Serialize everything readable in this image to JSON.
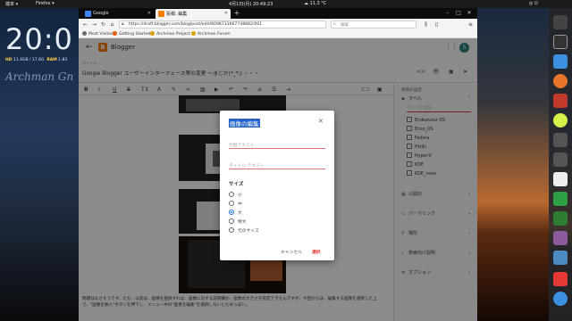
{
  "panel": {
    "menu": "端末 ▾",
    "app": "Firefox ▾",
    "datetime": "4月1日(月) 20:49:23",
    "weather": "☁ 11.3 °C"
  },
  "desktop": {
    "clock": "20:0",
    "stats_hd_label": "HD",
    "stats_hd": "11.4GB / 17.6G",
    "stats_ram_label": "RAM",
    "stats_ram": "1.83",
    "signature": "Archman Gn"
  },
  "browser": {
    "tabs": [
      {
        "label": "Google",
        "active": false,
        "color": "#4285f4"
      },
      {
        "label": "投稿: 編集",
        "active": true,
        "color": "#f57d00"
      }
    ],
    "url": "https://draft.blogger.com/blog/post/edit/6098733667748682/001",
    "search_placeholder": "検索",
    "bookmarks": [
      {
        "label": "Most Visited",
        "color": "#6a6a6a"
      },
      {
        "label": "Getting Started",
        "color": "#e66000"
      },
      {
        "label": "Archman Project",
        "color": "#d8a000"
      },
      {
        "label": "Archman Forum",
        "color": "#d8a000"
      }
    ]
  },
  "app": {
    "name": "Blogger",
    "avatar": "S",
    "title_hint": "タイトル",
    "post_title": "Google Blogger ユーザーインターフェース等の変更 ～まじか(*_*;) ・・・"
  },
  "editor": {
    "paragraph": "問題はなさそうです。ただ、以前は、画像を選択すれば、画像に対する説明欄か、画像の大きさを指定できたんですが、今回からは、編集する画像を選択した上で、\"画像を挿入\"ボタンを押下し、メニュー中の\"画像を編集\"を選択しないとだめっぽい。"
  },
  "sidebar": {
    "heading": "投稿の設定",
    "labels_section": "ラベル",
    "labels_placeholder": "ラベルを追加",
    "labels": [
      "Endeavour OS",
      "Enso_OS",
      "Fedora",
      "Hiziki",
      "Hyper-V",
      "KDE",
      "KDE_neon"
    ],
    "sections": [
      {
        "icon": "calendar-icon",
        "label": "公開日"
      },
      {
        "icon": "link-icon",
        "label": "パーマリンク"
      },
      {
        "icon": "location-icon",
        "label": "場所"
      },
      {
        "icon": "search-desc-icon",
        "label": "検索向け説明"
      },
      {
        "icon": "gear-icon",
        "label": "オプション"
      }
    ]
  },
  "dialog": {
    "title": "画像の編集",
    "alt_placeholder": "代替テキスト",
    "title_placeholder": "タイトル テキスト",
    "size_label": "サイズ",
    "sizes": [
      "小",
      "中",
      "大",
      "特大",
      "元のサイズ"
    ],
    "selected_size": "大",
    "cancel": "キャンセル",
    "ok": "選択"
  }
}
